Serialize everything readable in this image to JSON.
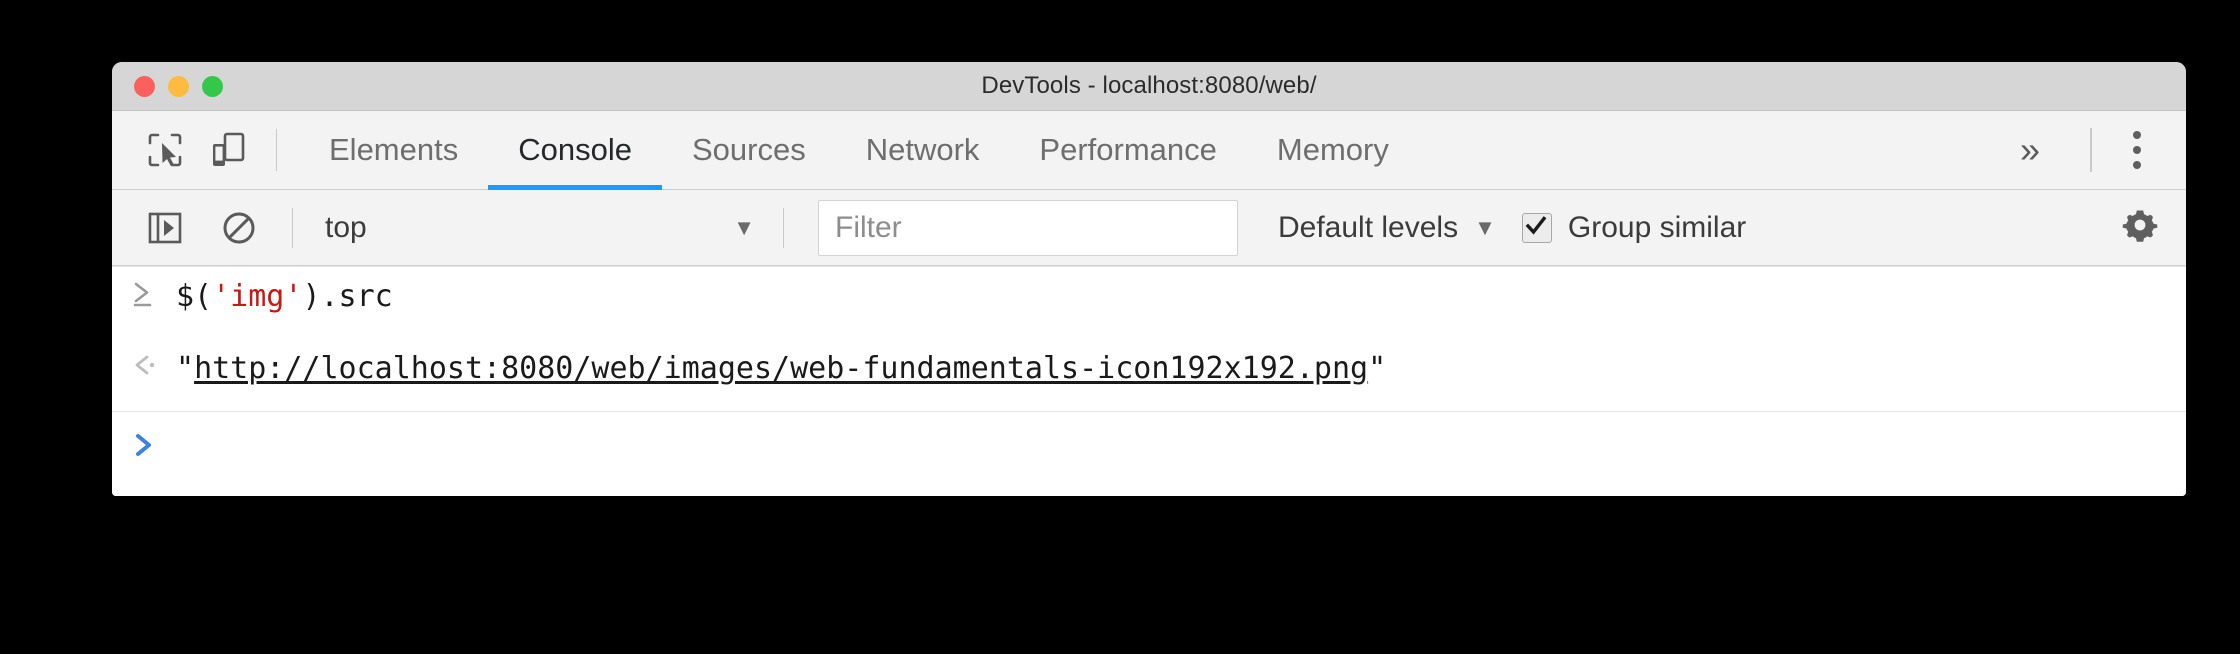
{
  "window": {
    "title": "DevTools - localhost:8080/web/",
    "traffic_lights": [
      {
        "name": "close",
        "color": "#fc605c"
      },
      {
        "name": "minimize",
        "color": "#fdbc40"
      },
      {
        "name": "zoom",
        "color": "#34c84a"
      }
    ]
  },
  "tabbar": {
    "inspect_icon": "inspect-element-icon",
    "device_icon": "device-toolbar-icon",
    "tabs": [
      {
        "label": "Elements",
        "active": false
      },
      {
        "label": "Console",
        "active": true
      },
      {
        "label": "Sources",
        "active": false
      },
      {
        "label": "Network",
        "active": false
      },
      {
        "label": "Performance",
        "active": false
      },
      {
        "label": "Memory",
        "active": false
      }
    ],
    "overflow_label": "»",
    "more_menu_icon": "kebab-menu-icon",
    "active_tab_color": "#1a9afa"
  },
  "console_toolbar": {
    "sidebar_toggle_icon": "console-sidebar-toggle-icon",
    "clear_icon": "clear-console-icon",
    "context": {
      "value": "top",
      "caret": "▼"
    },
    "filter": {
      "value": "",
      "placeholder": "Filter"
    },
    "levels": {
      "label": "Default levels",
      "caret": "▼"
    },
    "group_similar": {
      "label": "Group similar",
      "checked": true
    },
    "settings_icon": "gear-icon"
  },
  "console": {
    "rows": [
      {
        "type": "input",
        "gutter_icon": "input-prompt-chevron",
        "code_prefix": "$(",
        "code_string": "'img'",
        "code_suffix": ").src"
      },
      {
        "type": "output",
        "gutter_icon": "output-return-chevron",
        "quote_open": "\"",
        "url": "http://localhost:8080/web/images/web-fundamentals-icon192x192.png",
        "quote_close": "\""
      }
    ],
    "prompt": {
      "caret_icon": "prompt-chevron-icon",
      "caret_color": "#3e82de",
      "value": "",
      "placeholder": ""
    }
  }
}
